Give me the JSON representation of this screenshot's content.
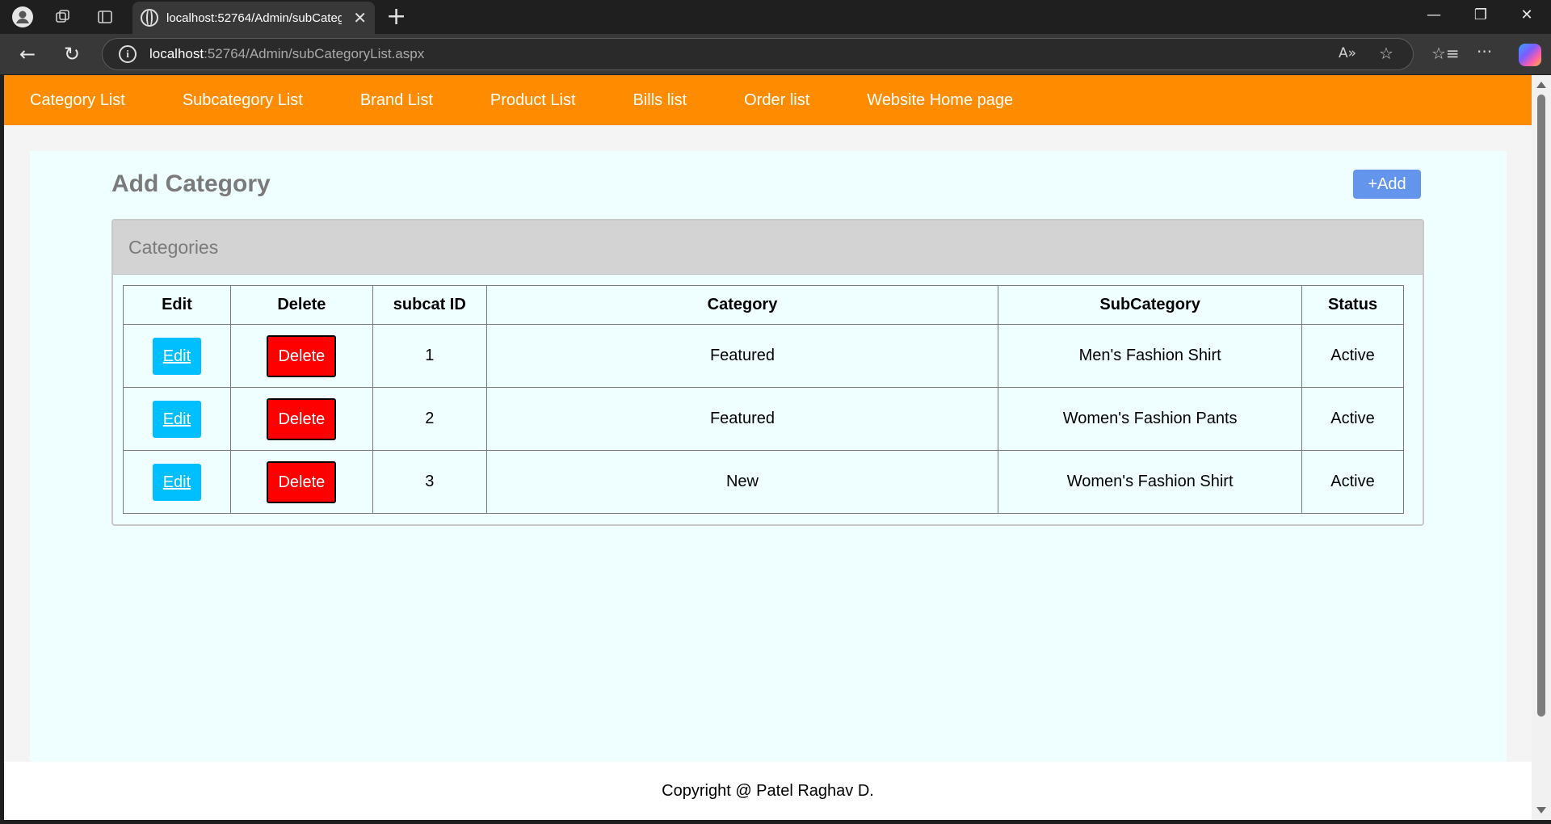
{
  "browser": {
    "tab_title": "localhost:52764/Admin/subCateg",
    "url_host": "localhost",
    "url_rest": ":52764/Admin/subCategoryList.aspx"
  },
  "nav": {
    "items": [
      "Category List",
      "Subcategory List",
      "Brand List",
      "Product List",
      "Bills list",
      "Order list",
      "Website Home page"
    ]
  },
  "page": {
    "title": "Add Category",
    "add_label": "+Add"
  },
  "card": {
    "header": "Categories"
  },
  "table": {
    "columns": [
      "Edit",
      "Delete",
      "subcat ID",
      "Category",
      "SubCategory",
      "Status"
    ],
    "rows": [
      {
        "edit": "Edit",
        "delete": "Delete",
        "id": "1",
        "category": "Featured",
        "subcategory": "Men's Fashion Shirt",
        "status": "Active"
      },
      {
        "edit": "Edit",
        "delete": "Delete",
        "id": "2",
        "category": "Featured",
        "subcategory": "Women's Fashion Pants",
        "status": "Active"
      },
      {
        "edit": "Edit",
        "delete": "Delete",
        "id": "3",
        "category": "New",
        "subcategory": "Women's Fashion Shirt",
        "status": "Active"
      }
    ]
  },
  "footer": {
    "text": "Copyright @ Patel Raghav D."
  },
  "colors": {
    "nav_bg": "#ff8c00",
    "content_bg": "#efffff",
    "add_button": "#6495ed",
    "edit_button": "#00bfff",
    "delete_button": "#ff0000"
  }
}
